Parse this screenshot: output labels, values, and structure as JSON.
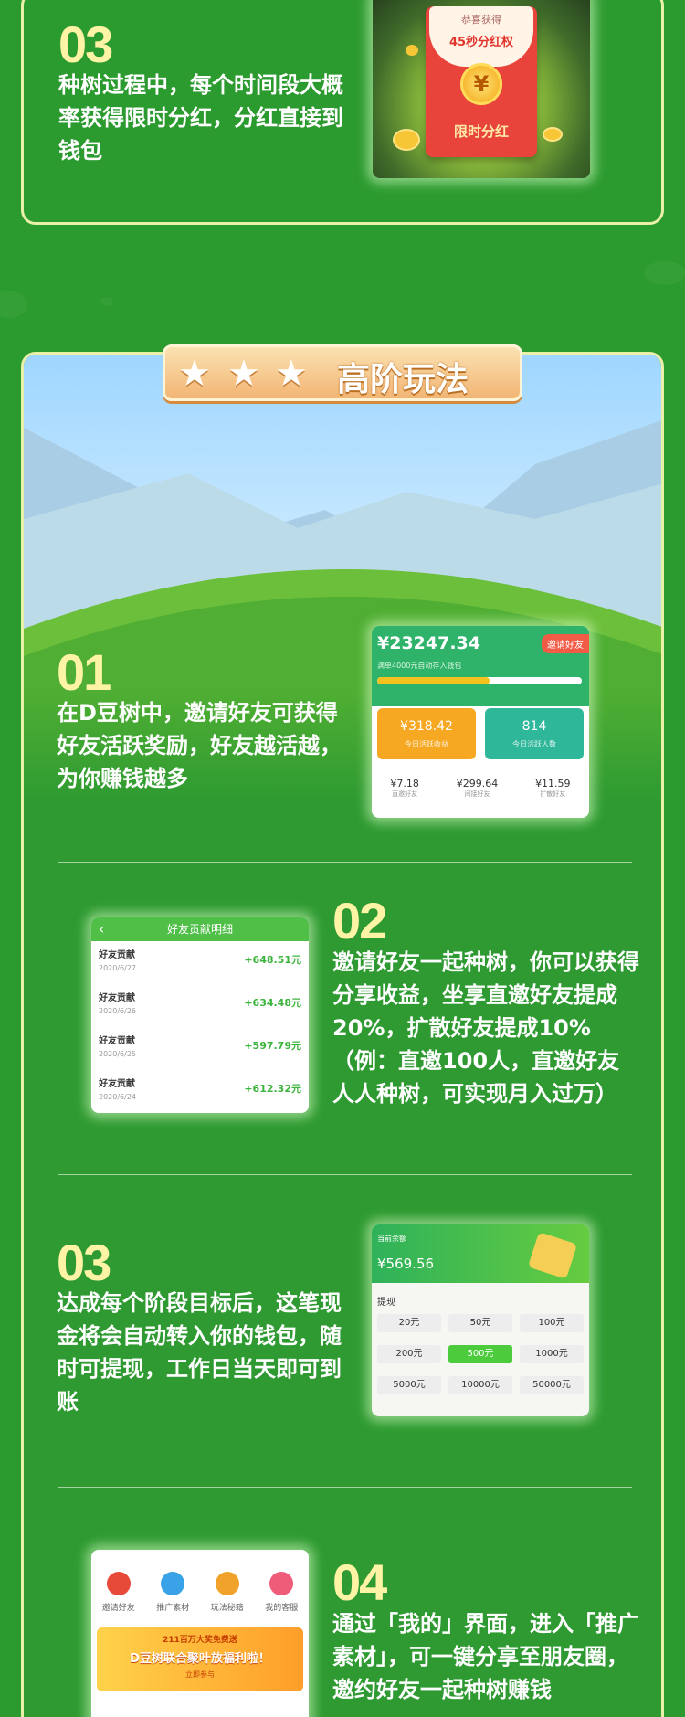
{
  "step_top": {
    "number": "03",
    "text": "种树过程中，每个时间段大概率获得限时分红，分红直接到钱包",
    "envelope": {
      "header": "恭喜获得",
      "title": "45秒分红权",
      "coin": "¥",
      "footer": "限时分红"
    }
  },
  "section": {
    "title": "高阶玩法",
    "stars": [
      "★",
      "★",
      "★"
    ]
  },
  "step1": {
    "number": "01",
    "text": "在D豆树中，邀请好友可获得好友活跃奖励，好友越活越，为你赚钱越多",
    "screen": {
      "balance": "¥23247.34",
      "invite_button": "邀请好友",
      "progress_caption": "满单4000元自动存入钱包",
      "progress": 0.55,
      "card_left_value": "¥318.42",
      "card_left_label": "今日活跃收益",
      "card_right_value": "814",
      "card_right_label": "今日活跃人数",
      "stats": [
        {
          "value": "¥7.18",
          "label": "直邀好友"
        },
        {
          "value": "¥299.64",
          "label": "间接好友"
        },
        {
          "value": "¥11.59",
          "label": "扩散好友"
        }
      ]
    }
  },
  "step2": {
    "number": "02",
    "text": "邀请好友一起种树，你可以获得分享收益，坐享直邀好友提成20%，扩散好友提成10%（例：直邀100人，直邀好友人人种树，可实现月入过万）",
    "screen": {
      "title": "好友贡献明细",
      "back": "‹",
      "rows": [
        {
          "label": "好友贡献",
          "date": "2020/6/27",
          "amount": "+648.51元"
        },
        {
          "label": "好友贡献",
          "date": "2020/6/26",
          "amount": "+634.48元"
        },
        {
          "label": "好友贡献",
          "date": "2020/6/25",
          "amount": "+597.79元"
        },
        {
          "label": "好友贡献",
          "date": "2020/6/24",
          "amount": "+612.32元"
        }
      ]
    }
  },
  "step3": {
    "number": "03",
    "text": "达成每个阶段目标后，这笔现金将会自动转入你的钱包，随时可提现，工作日当天即可到账",
    "screen": {
      "balance_label": "当前余额",
      "balance": "¥569.56",
      "withdraw_label": "提现",
      "options": [
        "20元",
        "50元",
        "100元",
        "200元",
        "500元",
        "1000元",
        "5000元",
        "10000元",
        "50000元"
      ],
      "selected": "500元"
    }
  },
  "step4": {
    "number": "04",
    "text": "通过「我的」界面，进入「推广素材」，可一键分享至朋友圈，邀约好友一起种树赚钱",
    "screen": {
      "menu": [
        {
          "label": "邀请好友",
          "icon": "red-envelope-icon",
          "color": "#e84a3a"
        },
        {
          "label": "推广素材",
          "icon": "picture-icon",
          "color": "#3aa3e8"
        },
        {
          "label": "玩法秘籍",
          "icon": "book-icon",
          "color": "#f0a22a"
        },
        {
          "label": "我的客服",
          "icon": "chat-icon",
          "color": "#ef5c7a"
        }
      ],
      "promo_top": "211百万大奖免费送",
      "promo_main": "D豆树联合聚叶放福利啦！",
      "promo_sub": "立即参与"
    }
  },
  "colors": {
    "accent_yellow": "#fff3a6",
    "green": "#2e9a31",
    "orange": "#f7a822",
    "teal": "#2fb79a"
  }
}
